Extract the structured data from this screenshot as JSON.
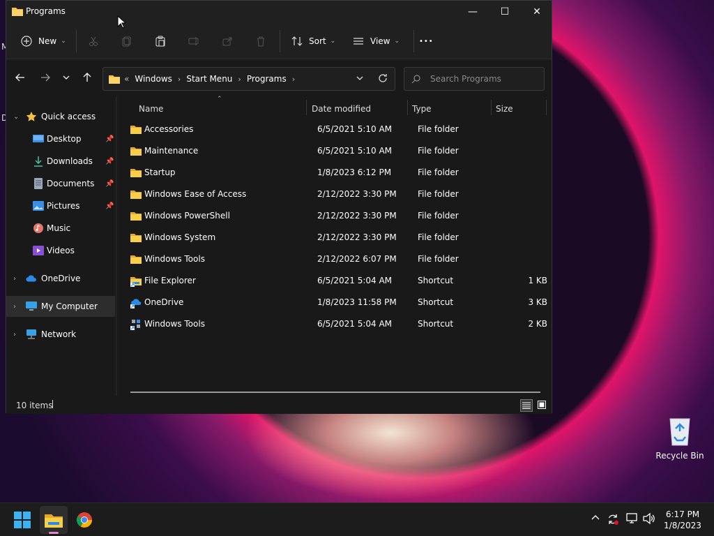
{
  "desktop": {
    "partial_labels": [
      "M",
      "D"
    ],
    "recycle_bin_label": "Recycle Bin"
  },
  "window": {
    "title": "Programs",
    "controls": {
      "minimize": "—",
      "maximize": "☐",
      "close": "✕"
    }
  },
  "toolbar": {
    "new_label": "New",
    "sort_label": "Sort",
    "view_label": "View",
    "more_label": "•••"
  },
  "navigation": {
    "breadcrumbs": [
      "Windows",
      "Start Menu",
      "Programs"
    ],
    "overflow_glyph": "«",
    "search_placeholder": "Search Programs"
  },
  "sidebar": {
    "items": [
      {
        "label": "Quick access",
        "icon": "star-icon"
      },
      {
        "label": "Desktop",
        "icon": "desktop-folder-icon",
        "pinned": true
      },
      {
        "label": "Downloads",
        "icon": "download-icon",
        "pinned": true
      },
      {
        "label": "Documents",
        "icon": "document-icon",
        "pinned": true
      },
      {
        "label": "Pictures",
        "icon": "picture-icon",
        "pinned": true
      },
      {
        "label": "Music",
        "icon": "music-icon"
      },
      {
        "label": "Videos",
        "icon": "video-icon"
      },
      {
        "label": "OneDrive",
        "icon": "cloud-icon"
      },
      {
        "label": "My Computer",
        "icon": "computer-icon"
      },
      {
        "label": "Network",
        "icon": "network-icon"
      }
    ]
  },
  "table": {
    "columns": [
      "Name",
      "Date modified",
      "Type",
      "Size"
    ],
    "rows": [
      {
        "name": "Accessories",
        "date": "6/5/2021 5:10 AM",
        "type": "File folder",
        "size": "",
        "icon": "folder-icon"
      },
      {
        "name": "Maintenance",
        "date": "6/5/2021 5:10 AM",
        "type": "File folder",
        "size": "",
        "icon": "folder-icon"
      },
      {
        "name": "Startup",
        "date": "1/8/2023 6:12 PM",
        "type": "File folder",
        "size": "",
        "icon": "folder-icon"
      },
      {
        "name": "Windows Ease of Access",
        "date": "2/12/2022 3:30 PM",
        "type": "File folder",
        "size": "",
        "icon": "folder-icon"
      },
      {
        "name": "Windows PowerShell",
        "date": "2/12/2022 3:30 PM",
        "type": "File folder",
        "size": "",
        "icon": "folder-icon"
      },
      {
        "name": "Windows System",
        "date": "2/12/2022 3:30 PM",
        "type": "File folder",
        "size": "",
        "icon": "folder-icon"
      },
      {
        "name": "Windows Tools",
        "date": "2/12/2022 6:07 PM",
        "type": "File folder",
        "size": "",
        "icon": "folder-icon"
      },
      {
        "name": "File Explorer",
        "date": "6/5/2021 5:04 AM",
        "type": "Shortcut",
        "size": "1 KB",
        "icon": "file-explorer-shortcut-icon"
      },
      {
        "name": "OneDrive",
        "date": "1/8/2023 11:58 PM",
        "type": "Shortcut",
        "size": "3 KB",
        "icon": "onedrive-shortcut-icon"
      },
      {
        "name": "Windows Tools",
        "date": "6/5/2021 5:04 AM",
        "type": "Shortcut",
        "size": "2 KB",
        "icon": "windows-tools-shortcut-icon"
      }
    ]
  },
  "status": {
    "item_count": "10 items"
  },
  "taskbar": {
    "clock_time": "6:17 PM",
    "clock_date": "1/8/2023"
  },
  "colors": {
    "folder": "#f5c242",
    "accent": "#60cdff"
  }
}
